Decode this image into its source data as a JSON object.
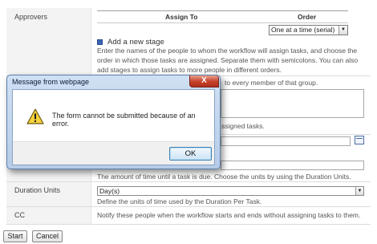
{
  "form": {
    "approvers_label": "Approvers",
    "assign_to_header": "Assign To",
    "order_header": "Order",
    "order_value": "One at a time (serial)",
    "add_stage_label": "Add a new stage",
    "approvers_help": [
      "Enter the names of the people to whom the workflow will assign tasks, and choose the",
      "order in which those tasks are assigned. Separate them with semicolons. You can also",
      "add stages to assign tasks to more people in different orders."
    ],
    "group_help_fragment": "to every member of that group.",
    "tasks_fragment": "ssigned tasks.",
    "duration_help": "The amount of time until a task is due. Choose the units by using the Duration Units.",
    "duration_units_label": "Duration Units",
    "duration_units_value": "Day(s)",
    "duration_units_help": "Define the units of time used by the Duration Per Task.",
    "cc_label": "CC",
    "cc_help": "Notify these people when the workflow starts and ends without assigning tasks to them.",
    "start_button": "Start",
    "cancel_button": "Cancel"
  },
  "dialog": {
    "title": "Message from webpage",
    "close_glyph": "X",
    "message": "The form cannot be submitted because of an error.",
    "ok_label": "OK"
  }
}
